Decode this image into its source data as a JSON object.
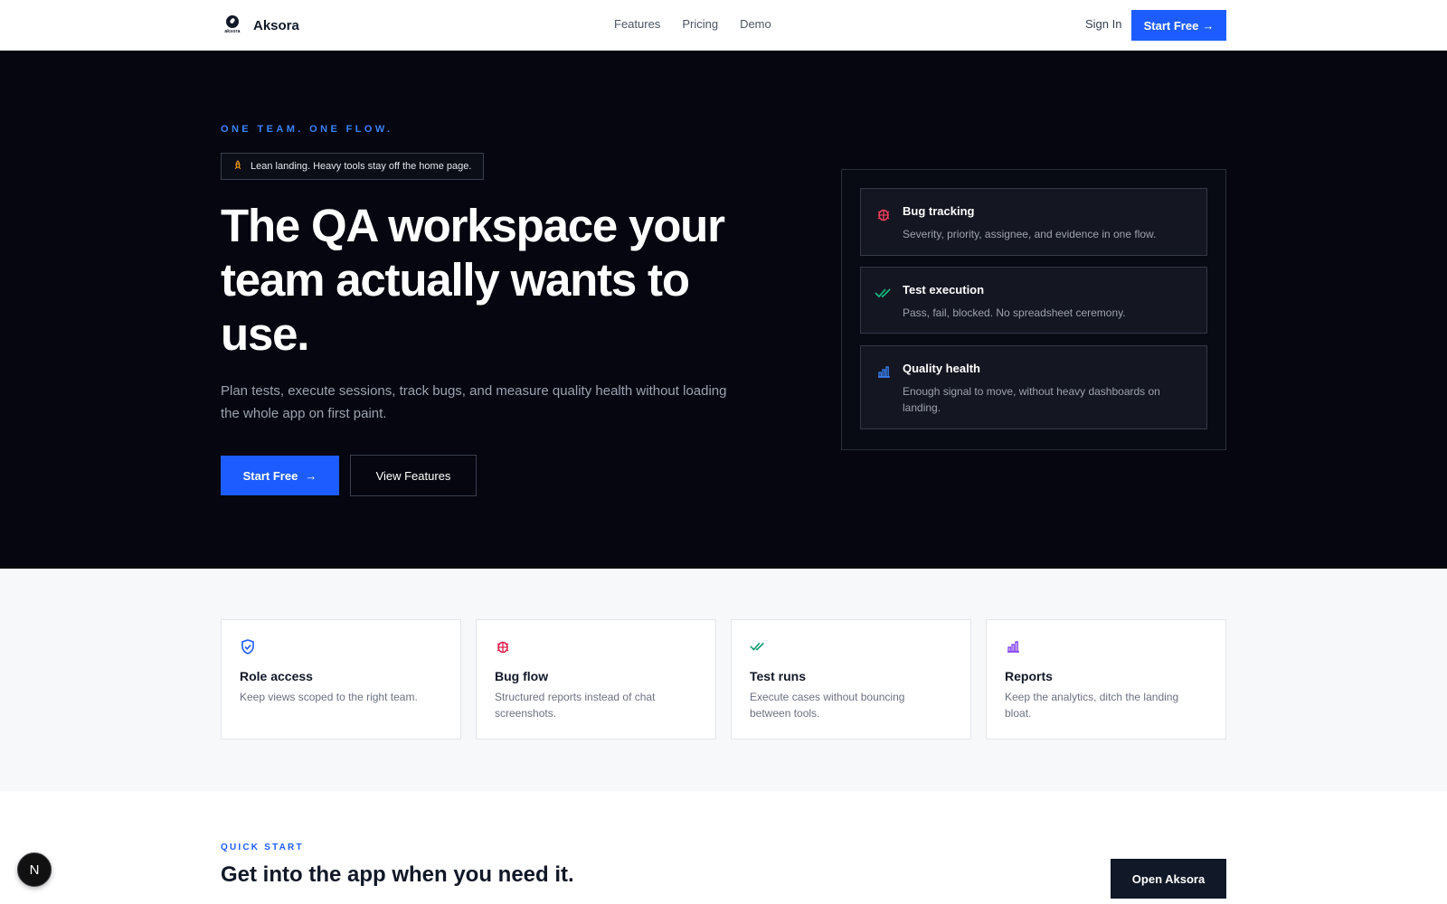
{
  "header": {
    "logo_text": "aksora",
    "brand": "Aksora",
    "nav": [
      "Features",
      "Pricing",
      "Demo"
    ],
    "sign_in": "Sign In",
    "cta": "Start Free",
    "cta_arrow": "→"
  },
  "hero": {
    "eyebrow": "ONE TEAM. ONE FLOW.",
    "pill_icon": "rocket-icon",
    "pill_text": "Lean landing. Heavy tools stay off the home page.",
    "title": "The QA workspace your team actually wants to use.",
    "subtitle": "Plan tests, execute sessions, track bugs, and measure quality health without loading the whole app on first paint.",
    "primary_button": "Start Free",
    "primary_arrow": "→",
    "secondary_button": "View Features",
    "features": [
      {
        "icon": "bug-icon",
        "title": "Bug tracking",
        "description": "Severity, priority, assignee, and evidence in one flow.",
        "color": "#f43f5e"
      },
      {
        "icon": "check-double-icon",
        "title": "Test execution",
        "description": "Pass, fail, blocked. No spreadsheet ceremony.",
        "color": "#10b981"
      },
      {
        "icon": "bar-chart-icon",
        "title": "Quality health",
        "description": "Enough signal to move, without heavy dashboards on landing.",
        "color": "#3b82f6"
      }
    ]
  },
  "cards": [
    {
      "icon": "shield-check-icon",
      "title": "Role access",
      "description": "Keep views scoped to the right team.",
      "color": "#1d5cff"
    },
    {
      "icon": "bug-icon",
      "title": "Bug flow",
      "description": "Structured reports instead of chat screenshots.",
      "color": "#e11d48"
    },
    {
      "icon": "check-double-icon",
      "title": "Test runs",
      "description": "Execute cases without bouncing between tools.",
      "color": "#059669"
    },
    {
      "icon": "bar-chart-icon",
      "title": "Reports",
      "description": "Keep the analytics, ditch the landing bloat.",
      "color": "#7c3aed"
    }
  ],
  "quick_start": {
    "eyebrow": "QUICK START",
    "title": "Get into the app when you need it.",
    "button": "Open Aksora"
  },
  "dev_badge": "N"
}
